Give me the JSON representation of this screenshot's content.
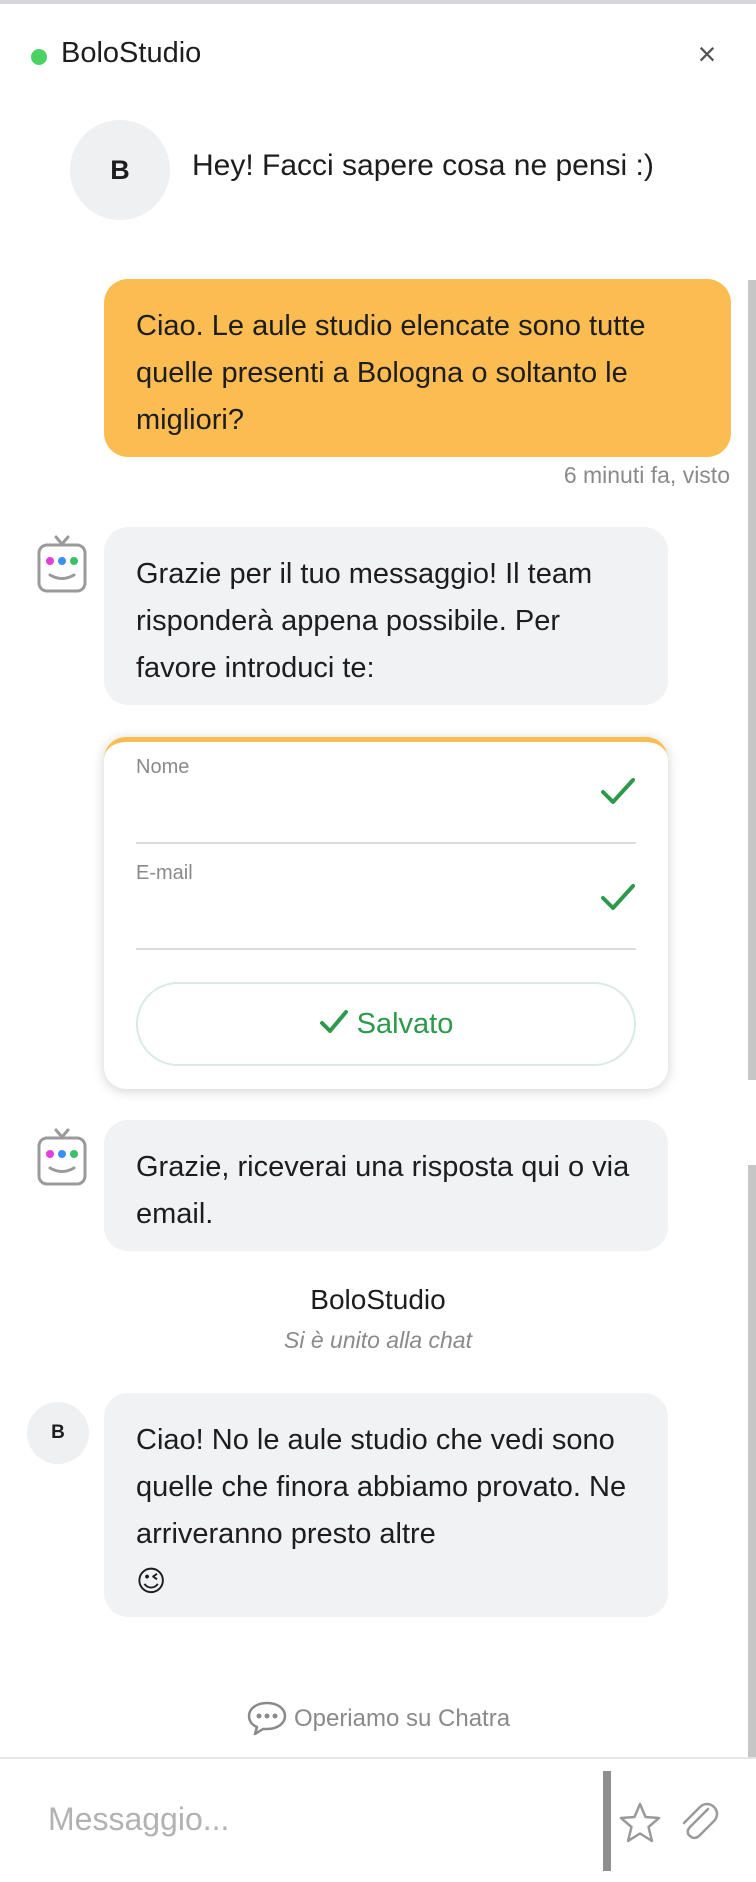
{
  "header": {
    "title": "BoloStudio",
    "close_glyph": "×",
    "online_color": "#4cd264"
  },
  "welcome": {
    "avatar_letter": "B",
    "text": "Hey! Facci sapere cosa ne pensi :)"
  },
  "messages": {
    "user_1": "Ciao. Le aule studio elencate sono tutte quelle presenti a Bologna o soltanto le migliori?",
    "user_1_meta": "6 minuti fa, visto",
    "bot_1": "Grazie per il tuo messaggio! Il team risponderà appena possibile. Per favore introduci te:",
    "bot_2": "Grazie, riceverai una risposta qui o via email.",
    "agent_1": "Ciao! No le aule studio che vedi sono quelle che finora abbiamo provato. Ne arriveranno presto altre",
    "agent_1_emoji": "😉"
  },
  "form": {
    "name_label": "Nome",
    "email_label": "E-mail",
    "saved_label": "Salvato",
    "accent_color": "#fbbc52",
    "check_color": "#2c9a4a"
  },
  "joined": {
    "name": "BoloStudio",
    "status": "Si è unito alla chat"
  },
  "agent": {
    "avatar_letter": "B"
  },
  "footer": {
    "powered_by": "Operiamo su Chatra"
  },
  "composer": {
    "placeholder": "Messaggio...",
    "value": ""
  },
  "icons": {
    "bot": "bot-face-icon",
    "check": "check-icon",
    "chat": "chat-bubble-icon",
    "star": "star-icon",
    "attach": "paperclip-icon"
  },
  "colors": {
    "user_bubble": "#fbbc52",
    "bot_bubble": "#f1f2f4"
  }
}
